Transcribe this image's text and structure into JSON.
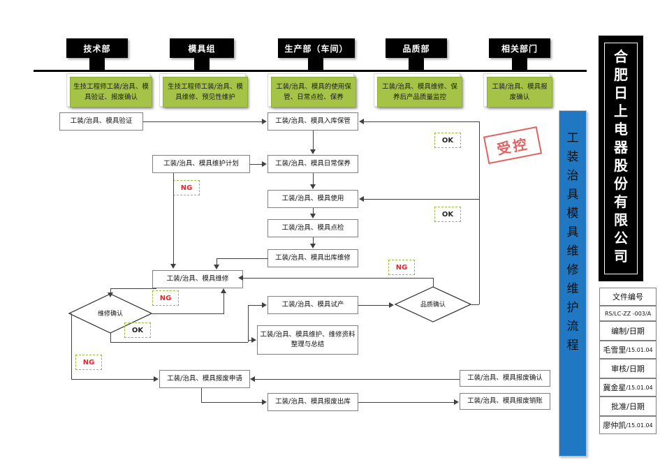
{
  "document": {
    "company_name_chars": [
      "合",
      "肥",
      "日",
      "上",
      "电",
      "器",
      "股",
      "份",
      "有",
      "限",
      "公",
      "司"
    ],
    "vertical_title_chars": [
      "工",
      "装",
      "治",
      "具",
      "模",
      "具",
      "维",
      "修",
      "维",
      "护",
      "流",
      "程"
    ],
    "stamp_text": "受控",
    "info_table": [
      {
        "label": "文件编号",
        "value": "RS/LC-ZZ -003/A",
        "value_type": "code"
      },
      {
        "label": "编制/日期",
        "name": "毛雪里",
        "date": "/15.01.04"
      },
      {
        "label": "审核/日期",
        "name": "冀金星",
        "date": "/15.01.04"
      },
      {
        "label": "批准/日期",
        "name": "廖仲凯",
        "date": "/15.01.04"
      }
    ]
  },
  "lanes": [
    {
      "header": "技术部",
      "duty": "生技工程师工装/治具、模具验证、报废确认"
    },
    {
      "header": "模具组",
      "duty": "生技工程师工装/治具、模具维修、预见性维护"
    },
    {
      "header": "生产部（车间）",
      "duty": "工装/治具、模具的使用保管、日常点检、保养"
    },
    {
      "header": "品质部",
      "duty": "工装/治具、模具维修、保养后产品质量监控"
    },
    {
      "header": "相关部门",
      "duty": "工装/治具、模具报废确认"
    }
  ],
  "nodes": {
    "verify": "工装/治具、模具验证",
    "storage": "工装/治具、模具入库保管",
    "maint_plan": "工装/治具、模具维护计划",
    "daily_care": "工装/治具、模具日常保养",
    "use": "工装/治具、模具使用",
    "inspect": "工装/治具、模具点检",
    "out_repair": "工装/治具、模具出库维修",
    "repair": "工装/治具、模具维修",
    "trial": "工装/治具、模具试产",
    "archive": "工装/治具、模具维护、维修资料整理与总结",
    "scrap_apply": "工装/治具、模具报废申请",
    "scrap_out": "工装/治具、模具报废出库",
    "scrap_confirm": "工装/治具、模具报废确认",
    "scrap_cancel": "工装/治具、模具报废销账"
  },
  "decisions": {
    "repair_confirm": "维修确认",
    "quality_confirm": "品质确认"
  },
  "tags": {
    "ok": "OK",
    "ng": "NG"
  },
  "colors": {
    "lane_header_bg": "#000000",
    "duty_green": "#a5c347",
    "banner_blue": "#1f78c1",
    "tag_border": "#9bbb3a",
    "ng_red": "#e8262a",
    "stamp_red": "#d8413f",
    "connector": "#404040"
  }
}
